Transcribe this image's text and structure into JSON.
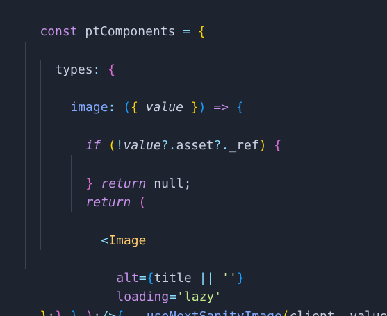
{
  "editor": {
    "language": "javascript",
    "colors": {
      "background": "#1e2330",
      "keyword": "#c792ea",
      "function": "#82aaff",
      "string": "#c3e88d",
      "tag": "#ffcb6b",
      "bracket_1": "#ffd700",
      "bracket_2": "#da70d6",
      "bracket_3": "#179fff"
    },
    "lines": [
      [
        "const",
        " ptComponents ",
        "=",
        " ",
        "{"
      ],
      [
        "types",
        ":",
        " ",
        "{"
      ],
      [
        "image",
        ":",
        " ",
        "(",
        "{",
        " ",
        "value",
        " ",
        "}",
        ")",
        " ",
        "=>",
        " ",
        "{"
      ],
      [
        "if",
        " ",
        "(",
        "!",
        "value",
        "?.",
        "asset",
        "?.",
        "_ref",
        ")",
        " ",
        "{"
      ],
      [
        "return",
        " ",
        "null",
        ";"
      ],
      [
        "}"
      ],
      [
        "return",
        " ",
        "("
      ],
      [
        "<",
        "Image"
      ],
      [
        "alt",
        "=",
        "{",
        "title",
        " ",
        "||",
        " ",
        "''",
        "}"
      ],
      [
        "loading",
        "=",
        "'lazy'"
      ],
      [
        "{",
        "...",
        "useNextSanityImage",
        "(",
        "client",
        ",",
        " ",
        "value",
        ")",
        "}"
      ],
      [
        "/>"
      ],
      [
        ")",
        ";"
      ],
      [
        "}",
        ","
      ],
      [
        "}",
        ","
      ],
      [
        "}",
        ";"
      ]
    ]
  }
}
